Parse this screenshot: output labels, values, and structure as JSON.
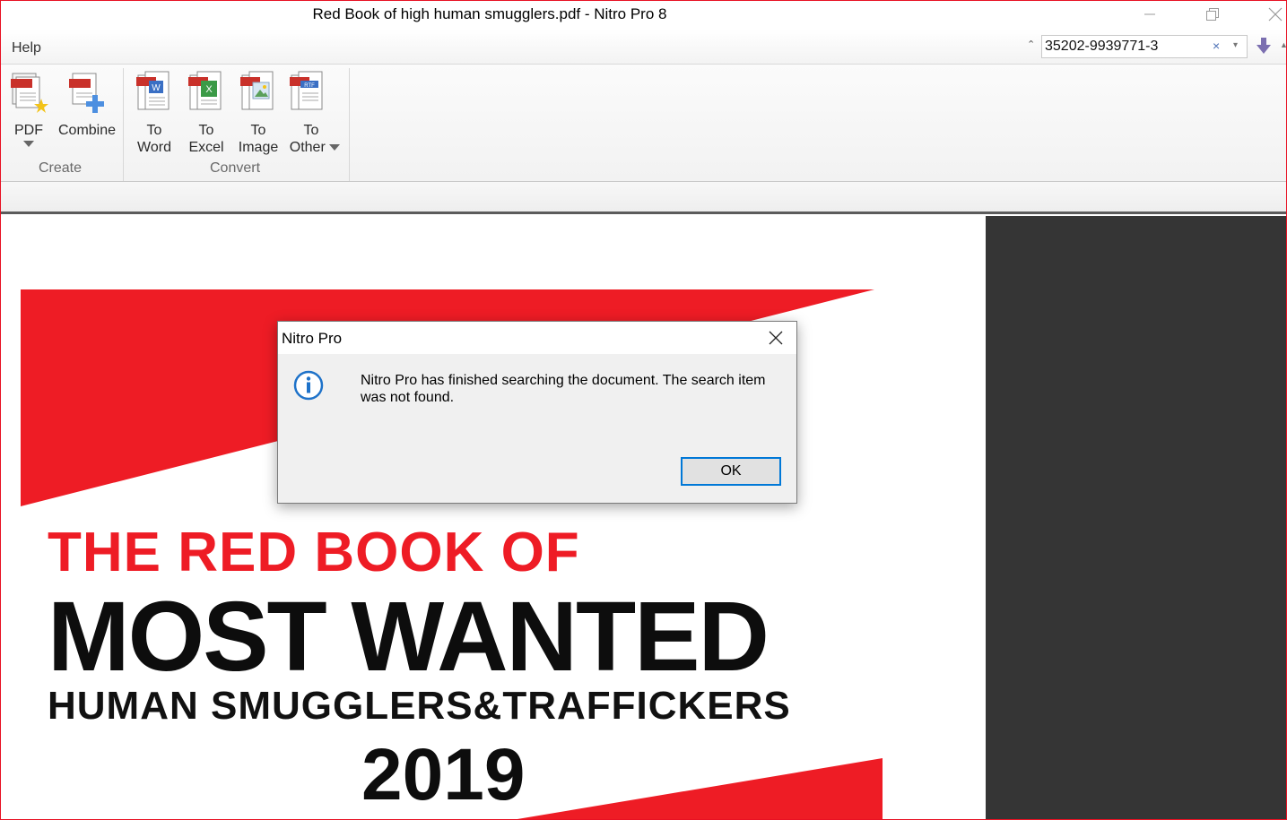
{
  "window": {
    "title": "Red Book of high human smugglers.pdf - Nitro Pro 8"
  },
  "menu": {
    "help_label": "Help"
  },
  "search": {
    "value": "35202-9939771-3",
    "clear_glyph": "×",
    "dropdown_glyph": "▾",
    "collapse_glyph": "⌃"
  },
  "ribbon": {
    "create_group_label": "Create",
    "convert_group_label": "Convert",
    "buttons": {
      "pdf": "PDF",
      "combine": "Combine",
      "to_word_line1": "To",
      "to_word_line2": "Word",
      "to_excel_line1": "To",
      "to_excel_line2": "Excel",
      "to_image_line1": "To",
      "to_image_line2": "Image",
      "to_other_line1": "To",
      "to_other_line2": "Other"
    },
    "icons": {
      "pdf": "pdf-create-icon",
      "combine": "combine-files-icon",
      "to_word": "word-document-icon",
      "to_excel": "excel-document-icon",
      "to_image": "image-document-icon",
      "to_other": "rtf-document-icon"
    }
  },
  "document": {
    "line1": "THE RED BOOK OF",
    "line2": "MOST WANTED",
    "line3": "HUMAN SMUGGLERS&TRAFFICKERS",
    "line4": "2019"
  },
  "dialog": {
    "title": "Nitro Pro",
    "message": "Nitro Pro has finished searching the document. The search item was not found.",
    "ok_label": "OK",
    "icon": "info-icon"
  },
  "colors": {
    "accent_blue": "#0078d7",
    "cover_red": "#ee1c25",
    "window_border": "#e81123",
    "side_panel": "#353535"
  }
}
